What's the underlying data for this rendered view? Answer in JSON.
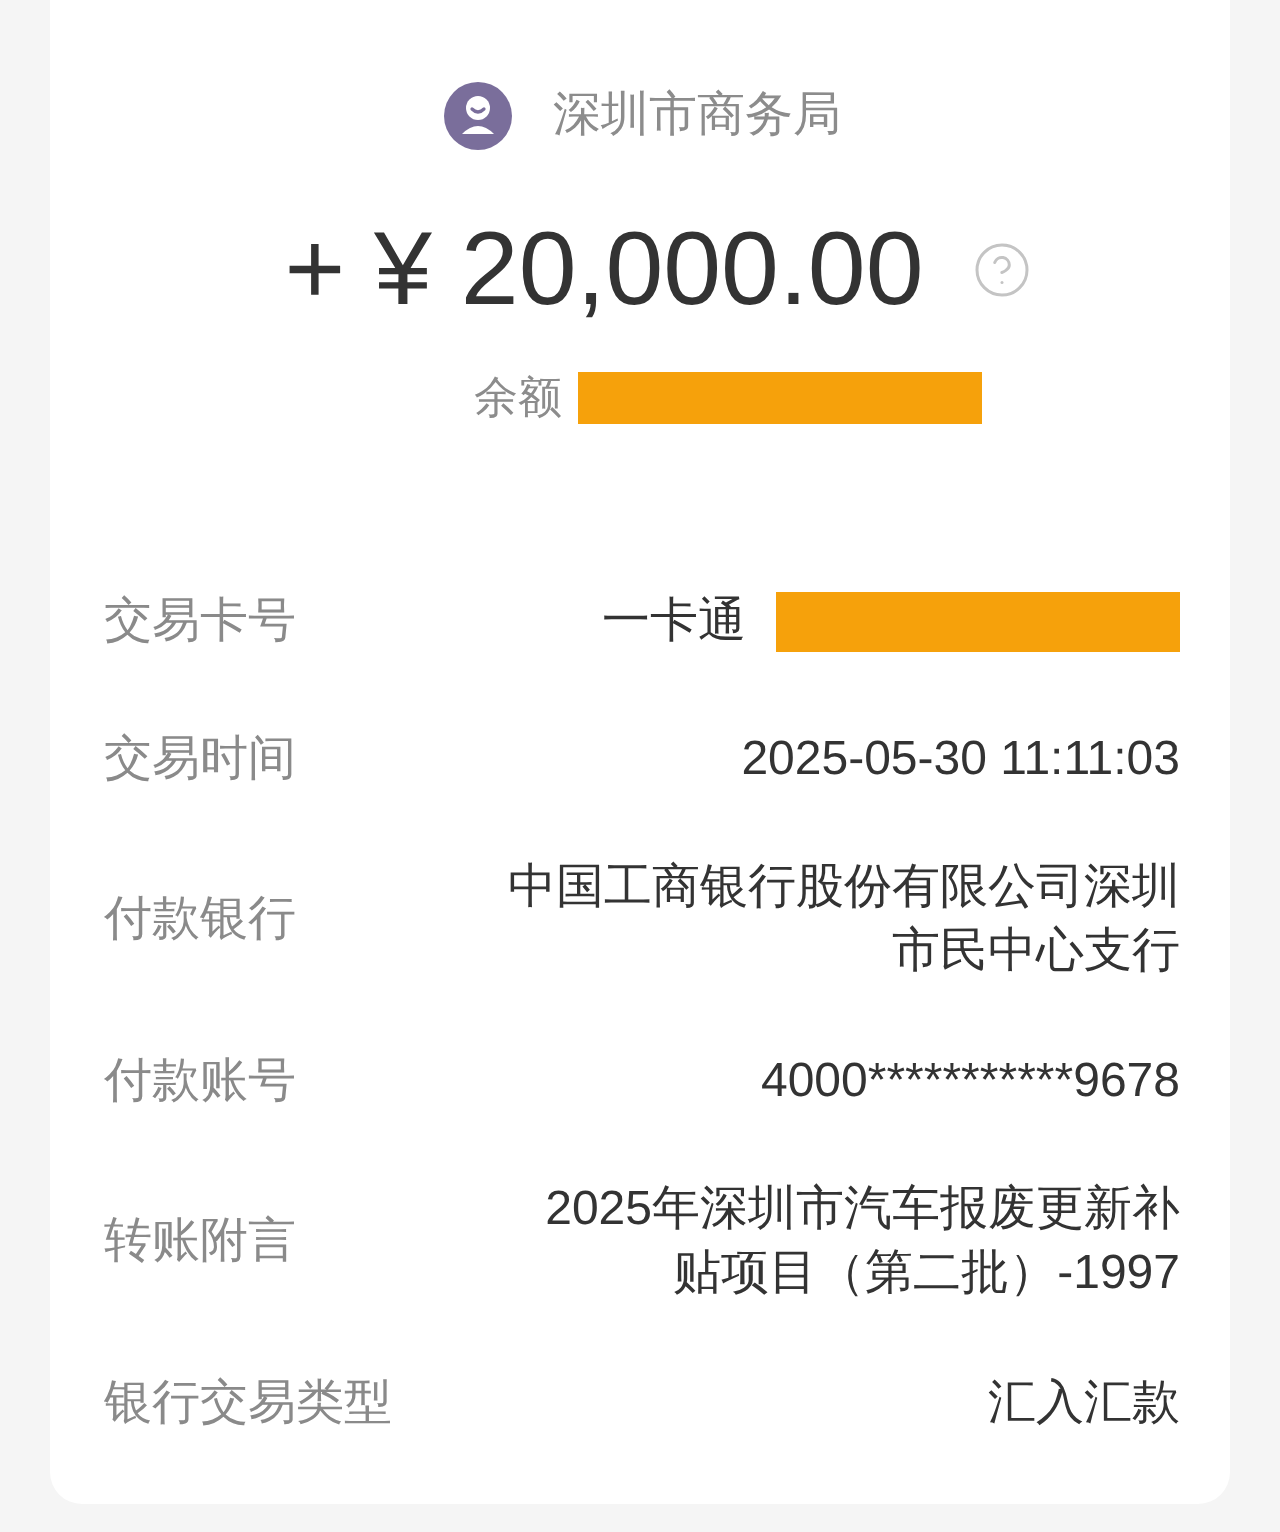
{
  "payer": {
    "name": "深圳市商务局"
  },
  "amount": {
    "text": "+ ¥ 20,000.00"
  },
  "balance": {
    "label": "余额",
    "redacted": true
  },
  "details": [
    {
      "label": "交易卡号",
      "value": "一卡通",
      "redacted": true
    },
    {
      "label": "交易时间",
      "value": "2025-05-30 11:11:03",
      "redacted": false
    },
    {
      "label": "付款银行",
      "value": "中国工商银行股份有限公司深圳市民中心支行",
      "redacted": false
    },
    {
      "label": "付款账号",
      "value": "4000***********9678",
      "redacted": false
    },
    {
      "label": "转账附言",
      "value": "2025年深圳市汽车报废更新补贴项目（第二批）-1997",
      "redacted": false
    },
    {
      "label": "银行交易类型",
      "value": "汇入汇款",
      "redacted": false
    }
  ]
}
